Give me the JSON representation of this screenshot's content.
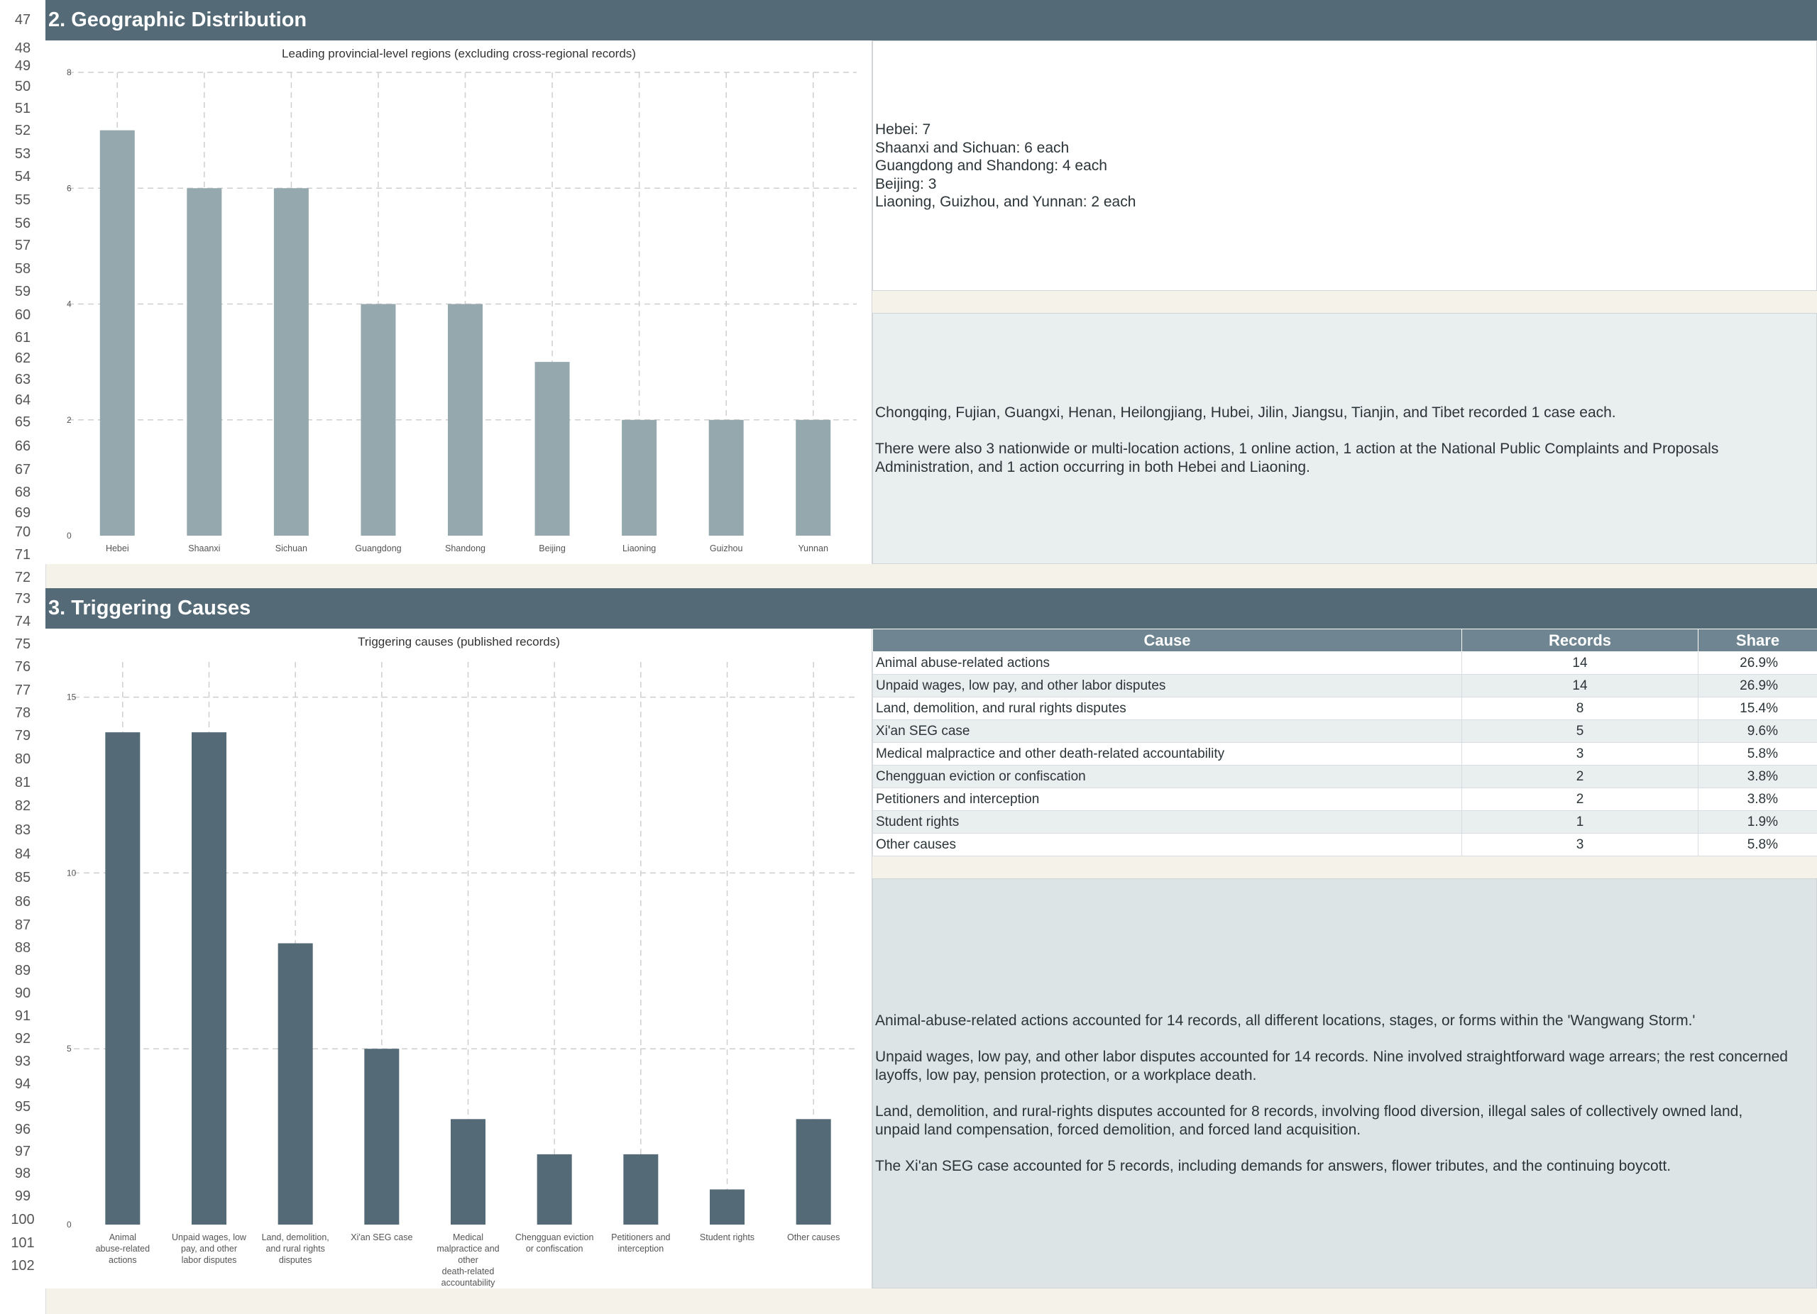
{
  "rows": {
    "start": 47,
    "end": 102,
    "tops": [
      0,
      57,
      80,
      106,
      138,
      168,
      200,
      234,
      264,
      300,
      330,
      362,
      396,
      426,
      462,
      491,
      520,
      550,
      578,
      612,
      646,
      678,
      710,
      736,
      765,
      800,
      829,
      860,
      892,
      924,
      956,
      990,
      1021,
      1054,
      1086,
      1120,
      1153,
      1187,
      1221,
      1254,
      1288,
      1320,
      1352,
      1384,
      1416,
      1448,
      1480,
      1512,
      1544,
      1577,
      1608,
      1639,
      1670,
      1702,
      1737,
      1768,
      1800
    ]
  },
  "sections": {
    "geo": {
      "title": "2. Geographic Distribution"
    },
    "causes": {
      "title": "3. Triggering Causes"
    }
  },
  "geo_notes": {
    "top": [
      "Hebei: 7",
      "Shaanxi and Sichuan: 6 each",
      "Guangdong and Shandong: 4 each",
      "Beijing: 3",
      "Liaoning, Guizhou, and Yunnan: 2 each"
    ],
    "bottom": [
      "Chongqing, Fujian, Guangxi, Henan, Heilongjiang, Hubei, Jilin, Jiangsu, Tianjin, and Tibet recorded 1 case each.",
      "There were also 3 nationwide or multi-location actions, 1 online action, 1 action at the National Public Complaints and Proposals Administration, and 1 action occurring in both Hebei and Liaoning."
    ]
  },
  "causes_table": {
    "headers": [
      "Cause",
      "Records",
      "Share"
    ],
    "rows": [
      [
        "Animal abuse-related actions",
        "14",
        "26.9%"
      ],
      [
        "Unpaid wages, low pay, and other labor disputes",
        "14",
        "26.9%"
      ],
      [
        "Land, demolition, and rural rights disputes",
        "8",
        "15.4%"
      ],
      [
        "Xi'an SEG case",
        "5",
        "9.6%"
      ],
      [
        "Medical malpractice and other death-related accountability",
        "3",
        "5.8%"
      ],
      [
        "Chengguan eviction or confiscation",
        "2",
        "3.8%"
      ],
      [
        "Petitioners and interception",
        "2",
        "3.8%"
      ],
      [
        "Student rights",
        "1",
        "1.9%"
      ],
      [
        "Other causes",
        "3",
        "5.8%"
      ]
    ]
  },
  "cause_notes": [
    "Animal-abuse-related actions accounted for 14 records, all different locations, stages, or forms within the 'Wangwang Storm.'",
    "Unpaid wages, low pay, and other labor disputes accounted for 14 records. Nine involved straightforward wage arrears; the rest concerned layoffs, low pay, pension protection, or a workplace death.",
    "Land, demolition, and rural-rights disputes accounted for 8 records, involving flood diversion, illegal sales of collectively owned land, unpaid land compensation, forced demolition, and forced land acquisition.",
    "The Xi'an SEG case accounted for 5 records, including demands for answers, flower tributes, and the continuing boycott."
  ],
  "chart_data": [
    {
      "type": "bar",
      "title": "Leading provincial-level regions (excluding cross-regional records)",
      "categories": [
        "Hebei",
        "Shaanxi",
        "Sichuan",
        "Guangdong",
        "Shandong",
        "Beijing",
        "Liaoning",
        "Guizhou",
        "Yunnan"
      ],
      "values": [
        7,
        6,
        6,
        4,
        4,
        3,
        2,
        2,
        2
      ],
      "ylim": [
        0,
        8
      ],
      "yticks": [
        0,
        2,
        4,
        6,
        8
      ],
      "grid": true,
      "color": "#94a8ae"
    },
    {
      "type": "bar",
      "title": "Triggering causes (published records)",
      "categories": [
        "Animal abuse-related actions",
        "Unpaid wages, low pay, and other labor disputes",
        "Land, demolition, and rural rights disputes",
        "Xi'an SEG case",
        "Medical malpractice and other death-related accountability",
        "Chengguan eviction or confiscation",
        "Petitioners and interception",
        "Student rights",
        "Other causes"
      ],
      "values": [
        14,
        14,
        8,
        5,
        3,
        2,
        2,
        1,
        3
      ],
      "ylim": [
        0,
        16
      ],
      "yticks": [
        0,
        5,
        10,
        15
      ],
      "grid": true,
      "color": "#546a76"
    }
  ]
}
